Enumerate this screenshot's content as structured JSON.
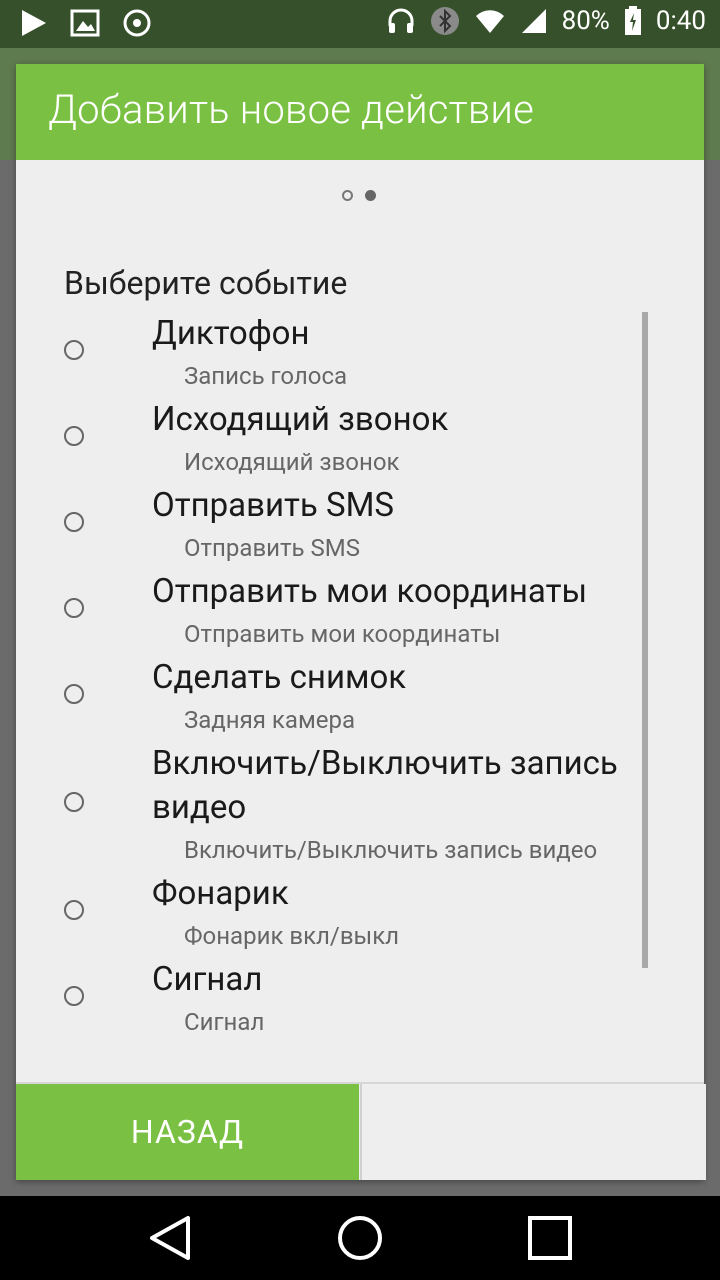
{
  "status_bar": {
    "battery": "80%",
    "time": "0:40",
    "icons": [
      "play-icon",
      "image-icon",
      "record-icon",
      "headset-icon",
      "bluetooth-icon",
      "wifi-icon",
      "signal-icon",
      "battery-icon"
    ]
  },
  "dialog": {
    "title": "Добавить новое действие",
    "pager_dots": {
      "count": 2,
      "active": 2
    },
    "section_label": "Выберите событие",
    "items": [
      {
        "title": "Диктофон",
        "subtitle": "Запись голоса"
      },
      {
        "title": "Исходящий звонок",
        "subtitle": "Исходящий звонок"
      },
      {
        "title": "Отправить SMS",
        "subtitle": "Отправить SMS"
      },
      {
        "title": "Отправить мои координаты",
        "subtitle": "Отправить мои координаты"
      },
      {
        "title": "Сделать снимок",
        "subtitle": "Задняя камера"
      },
      {
        "title": "Включить/Выключить запись видео",
        "subtitle": "Включить/Выключить запись видео"
      },
      {
        "title": "Фонарик",
        "subtitle": "Фонарик вкл/выкл"
      },
      {
        "title": "Сигнал",
        "subtitle": "Сигнал"
      }
    ],
    "back_label": "НАЗАД"
  },
  "colors": {
    "accent": "#7ac143",
    "background": "#eeeeee"
  }
}
